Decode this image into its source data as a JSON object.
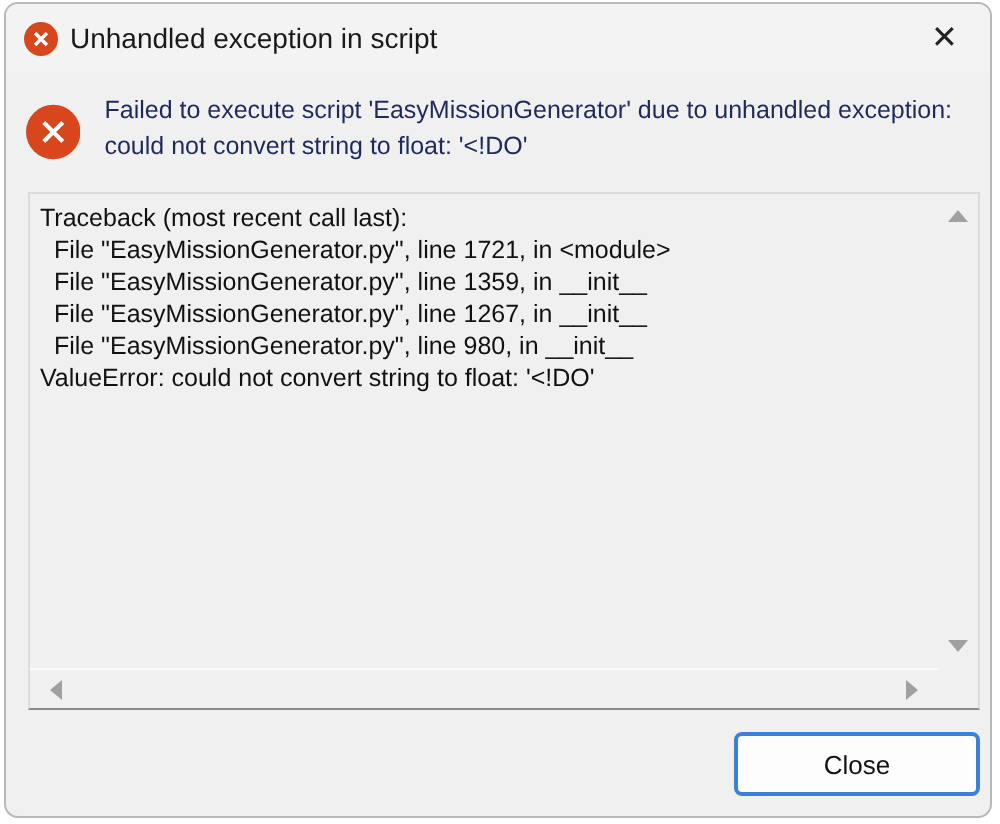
{
  "window": {
    "title": "Unhandled exception in script",
    "close_glyph": "✕"
  },
  "message": "Failed to execute script 'EasyMissionGenerator' due to unhandled exception: could not convert string to float: '<!DO'",
  "traceback": [
    "Traceback (most recent call last):",
    "  File \"EasyMissionGenerator.py\", line 1721, in <module>",
    "  File \"EasyMissionGenerator.py\", line 1359, in __init__",
    "  File \"EasyMissionGenerator.py\", line 1267, in __init__",
    "  File \"EasyMissionGenerator.py\", line 980, in __init__",
    "ValueError: could not convert string to float: '<!DO'"
  ],
  "buttons": [
    "Close"
  ]
}
